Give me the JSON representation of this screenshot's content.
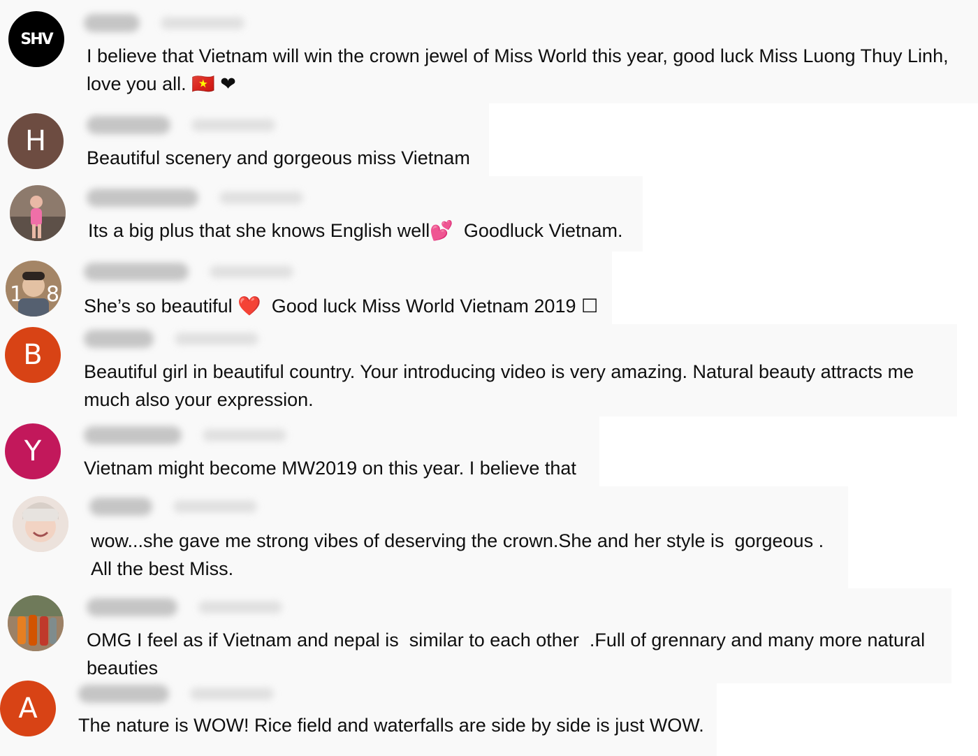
{
  "comments": [
    {
      "avatar_letter": "",
      "avatar_logo_text": "SHV",
      "avatar_color": "#000000",
      "text": "I believe that Vietnam will win the crown jewel of Miss World this year, good luck Miss Luong Thuy Linh,\nlove you all. 🇻🇳 ❤"
    },
    {
      "avatar_letter": "H",
      "avatar_color": "#6d4c41",
      "text": "Beautiful scenery and gorgeous miss Vietnam"
    },
    {
      "avatar_letter": "",
      "avatar_color": "#c8a8a0",
      "text": "Its a big plus that she knows English well💕  Goodluck Vietnam."
    },
    {
      "avatar_letter": "",
      "avatar_color": "#b89a80",
      "text": "She’s so beautiful ❤️  Good luck Miss World Vietnam 2019 ☐"
    },
    {
      "avatar_letter": "B",
      "avatar_color": "#d84315",
      "text": "Beautiful girl in beautiful country. Your introducing video is very amazing. Natural beauty attracts me\nmuch also your expression."
    },
    {
      "avatar_letter": "Y",
      "avatar_color": "#c2185b",
      "text": "Vietnam might become MW2019 on this year. I believe that"
    },
    {
      "avatar_letter": "",
      "avatar_color": "#e6d3c8",
      "text": "wow...she gave me strong vibes of deserving the crown.She and her style is  gorgeous .\nAll the best Miss."
    },
    {
      "avatar_letter": "",
      "avatar_color": "#a88a6a",
      "text": "OMG I feel as if Vietnam and nepal is  similar to each other  .Full of grennary and many more natural\nbeauties"
    },
    {
      "avatar_letter": "A",
      "avatar_color": "#d84315",
      "text": "The nature is WOW! Rice field and waterfalls are side by side is just WOW."
    }
  ]
}
